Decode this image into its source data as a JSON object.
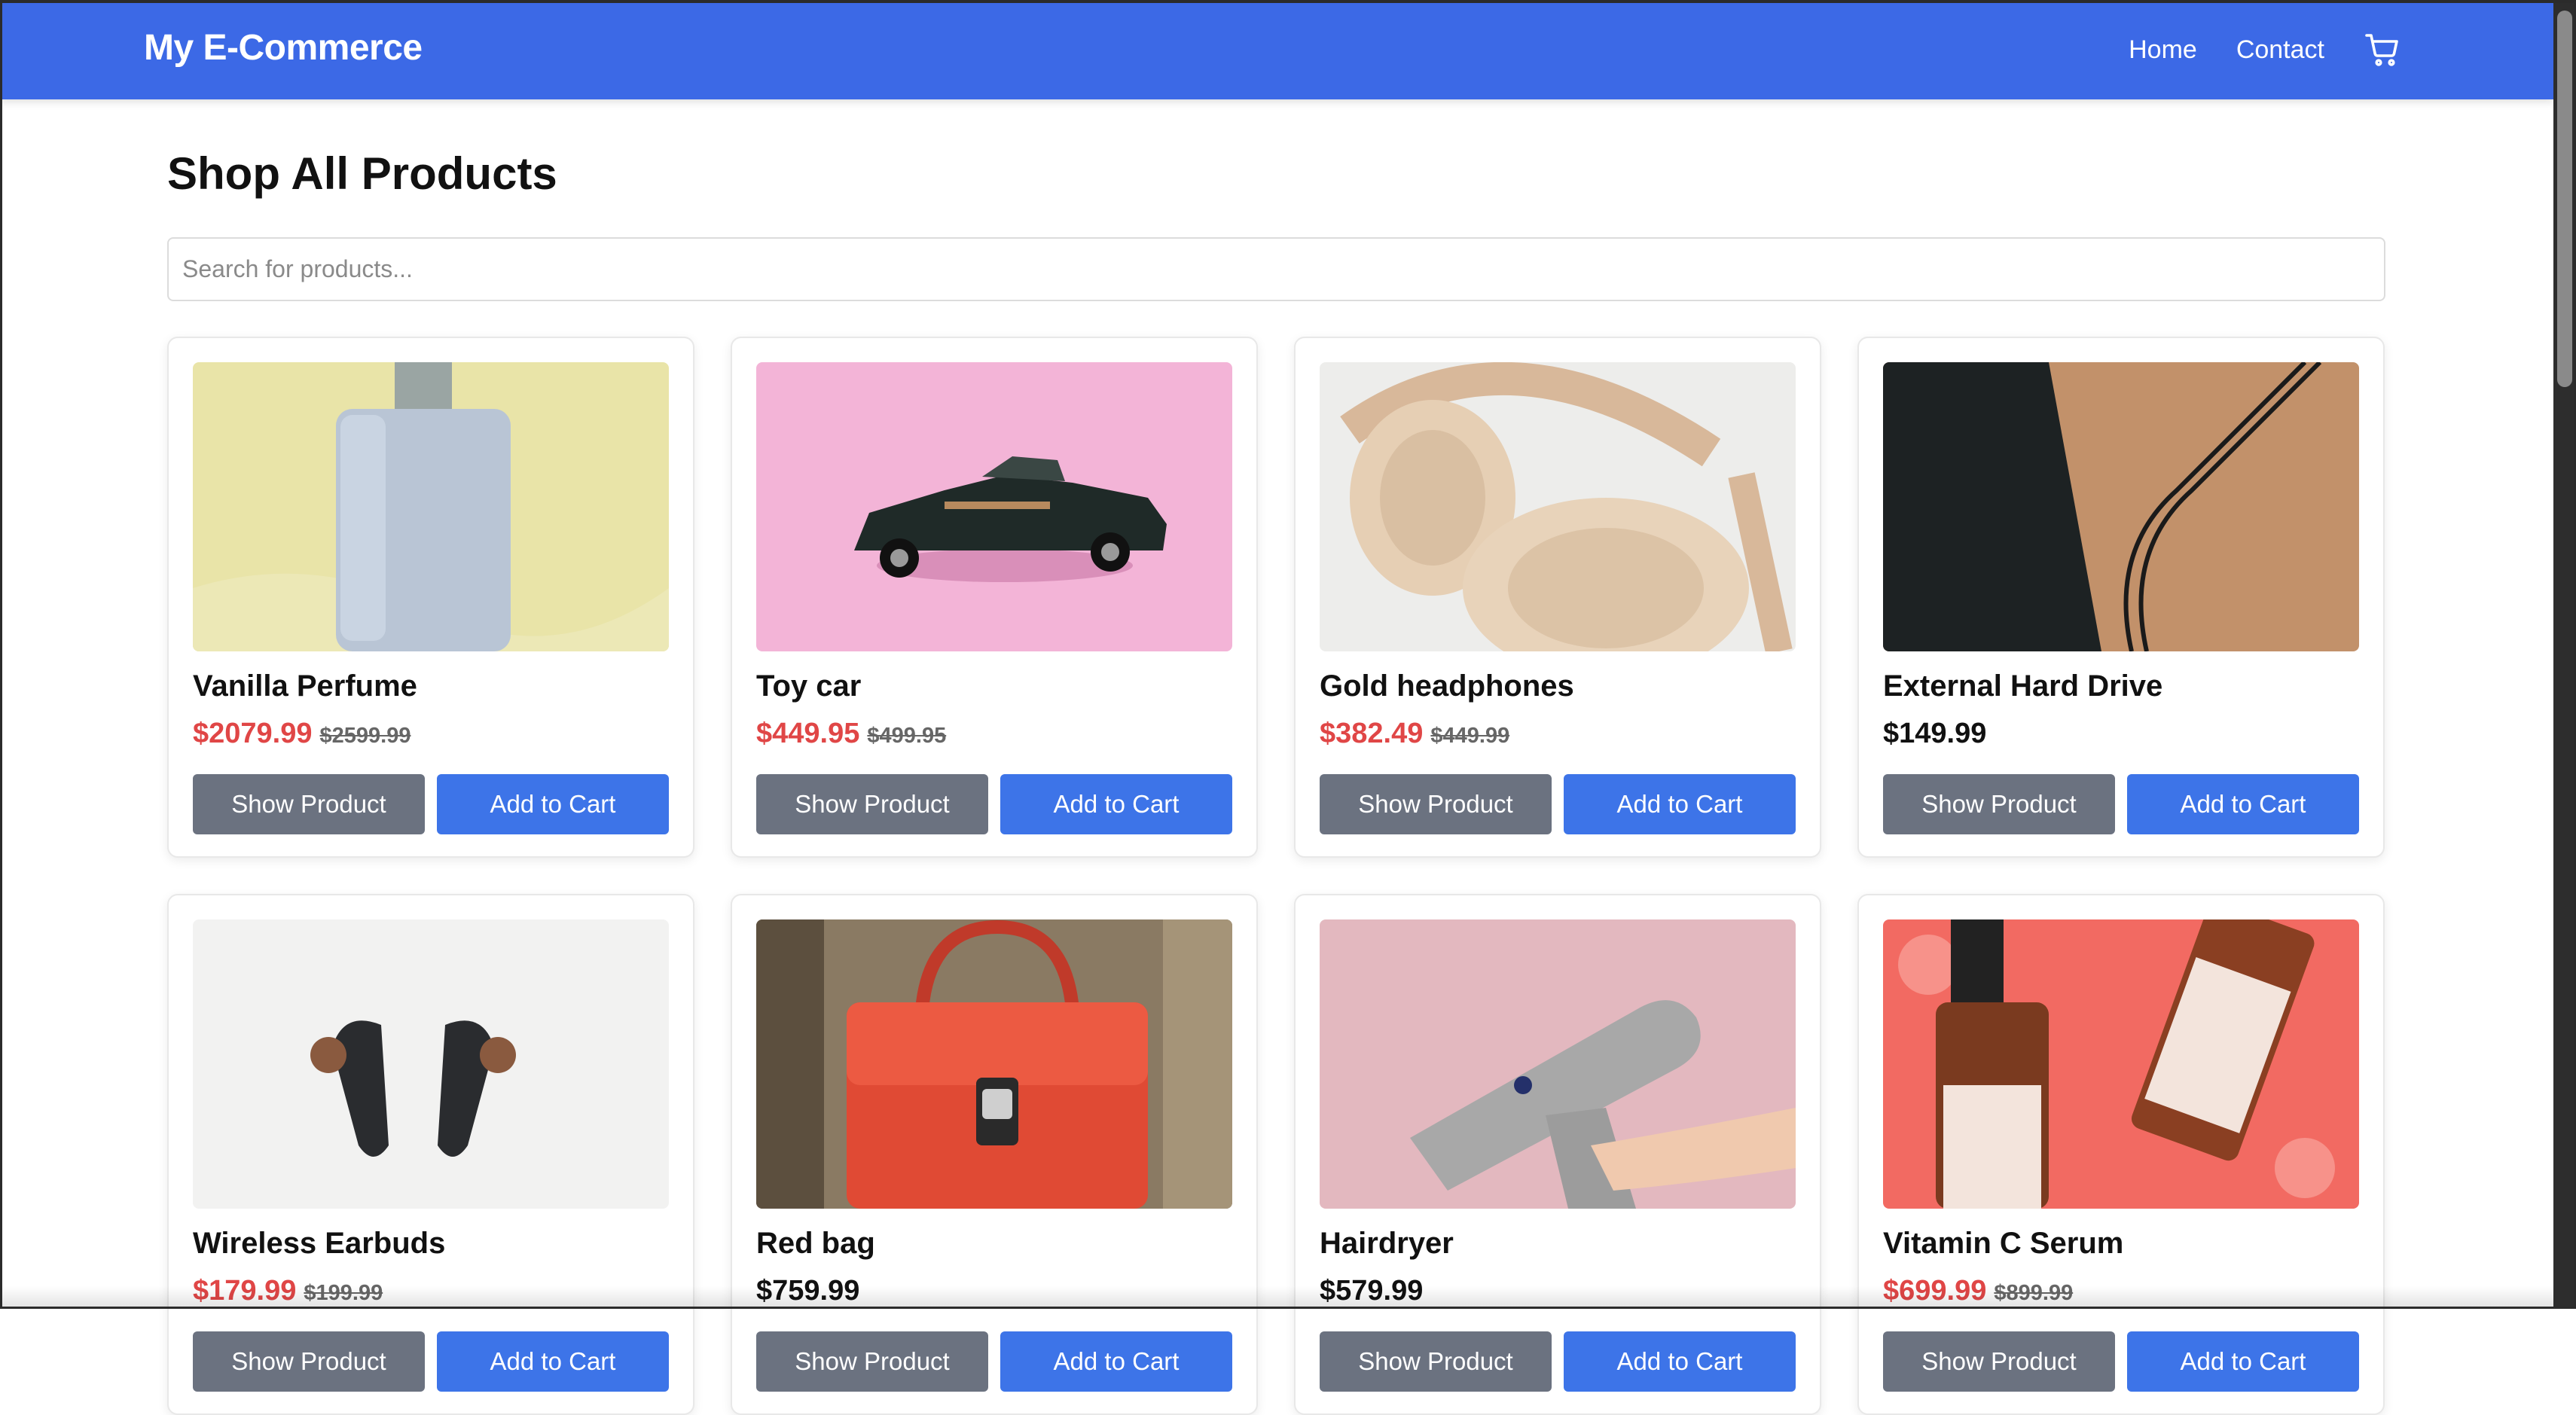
{
  "navbar": {
    "brand": "My E-Commerce",
    "links": [
      {
        "label": "Home"
      },
      {
        "label": "Contact"
      }
    ],
    "cart_icon": "cart-icon",
    "background": "#3c69e6"
  },
  "main": {
    "title": "Shop All Products",
    "search_placeholder": "Search for products..."
  },
  "buttons": {
    "show": "Show Product",
    "add": "Add to Cart"
  },
  "colors": {
    "sale_price": "#e04646",
    "show_button": "#6b7280",
    "add_button": "#3d74e8"
  },
  "products": [
    {
      "name": "Vanilla Perfume",
      "price": "$2079.99",
      "original_price": "$2599.99",
      "image": "perfume-bottle-image"
    },
    {
      "name": "Toy car",
      "price": "$449.95",
      "original_price": "$499.95",
      "image": "toy-car-image"
    },
    {
      "name": "Gold headphones",
      "price": "$382.49",
      "original_price": "$449.99",
      "image": "headphones-image"
    },
    {
      "name": "External Hard Drive",
      "price": "$149.99",
      "original_price": "",
      "image": "hard-drive-image"
    },
    {
      "name": "Wireless Earbuds",
      "price": "$179.99",
      "original_price": "$199.99",
      "image": "earbuds-image"
    },
    {
      "name": "Red bag",
      "price": "$759.99",
      "original_price": "",
      "image": "red-bag-image"
    },
    {
      "name": "Hairdryer",
      "price": "$579.99",
      "original_price": "",
      "image": "hairdryer-image"
    },
    {
      "name": "Vitamin C Serum",
      "price": "$699.99",
      "original_price": "$899.99",
      "image": "serum-image"
    }
  ]
}
